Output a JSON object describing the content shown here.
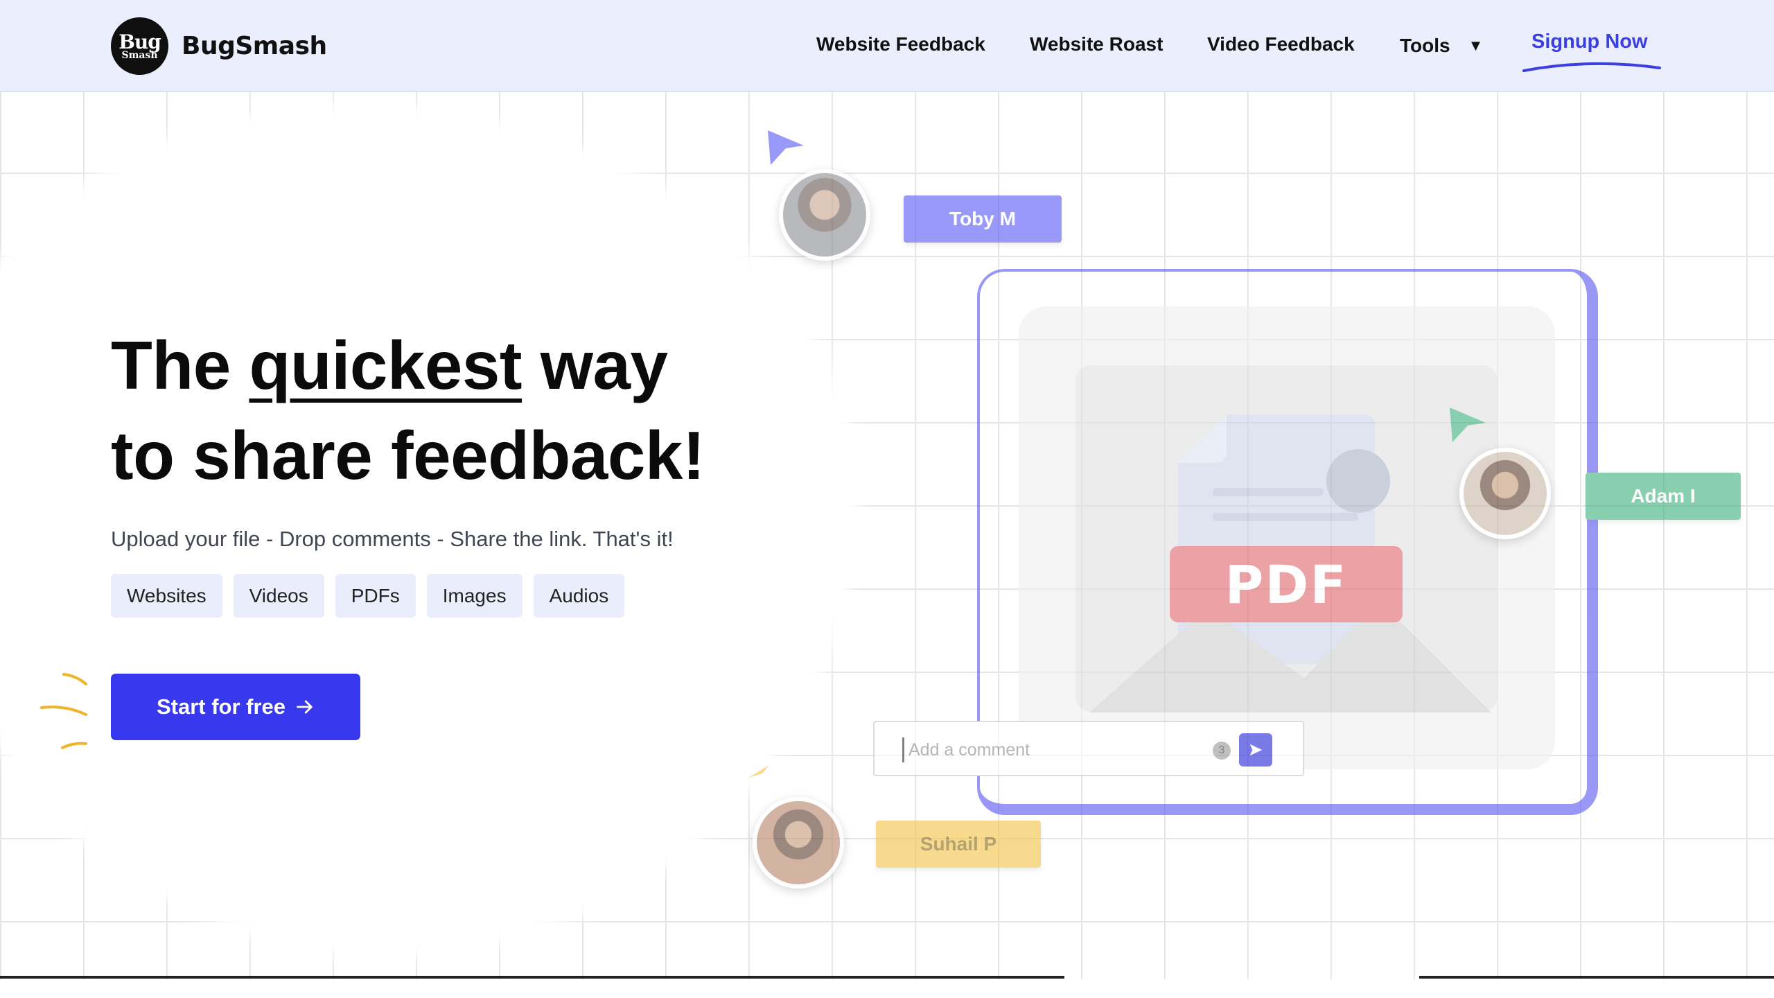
{
  "header": {
    "logo": {
      "line1": "Bug",
      "line2": "Smash"
    },
    "brand": "BugSmash",
    "nav": [
      {
        "label": "Website Feedback"
      },
      {
        "label": "Website Roast"
      },
      {
        "label": "Video Feedback"
      },
      {
        "label": "Tools",
        "icon": "caret-down-icon"
      }
    ],
    "signup": "Signup Now"
  },
  "hero": {
    "title_pre": "The ",
    "title_highlight": "quickest",
    "title_post": " way",
    "title_line2": "to share feedback!",
    "subtitle": "Upload your file - Drop comments - Share the link. That's it!",
    "chips": [
      "Websites",
      "Videos",
      "PDFs",
      "Images",
      "Audios"
    ],
    "cta": "Start for free",
    "cta_icon": "arrow-right-icon"
  },
  "illustration": {
    "badge": "PDF",
    "comment_placeholder": "Add a comment",
    "comment_count": "3",
    "users": [
      {
        "name": "Toby M",
        "color": "#5b5cf6"
      },
      {
        "name": "Adam I",
        "color": "#3fb27f"
      },
      {
        "name": "Suhail P",
        "color": "#f5c44a"
      }
    ]
  },
  "colors": {
    "accent": "#3838ee",
    "header_bg": "#ebeefc",
    "chip_bg": "#eaedfb"
  }
}
